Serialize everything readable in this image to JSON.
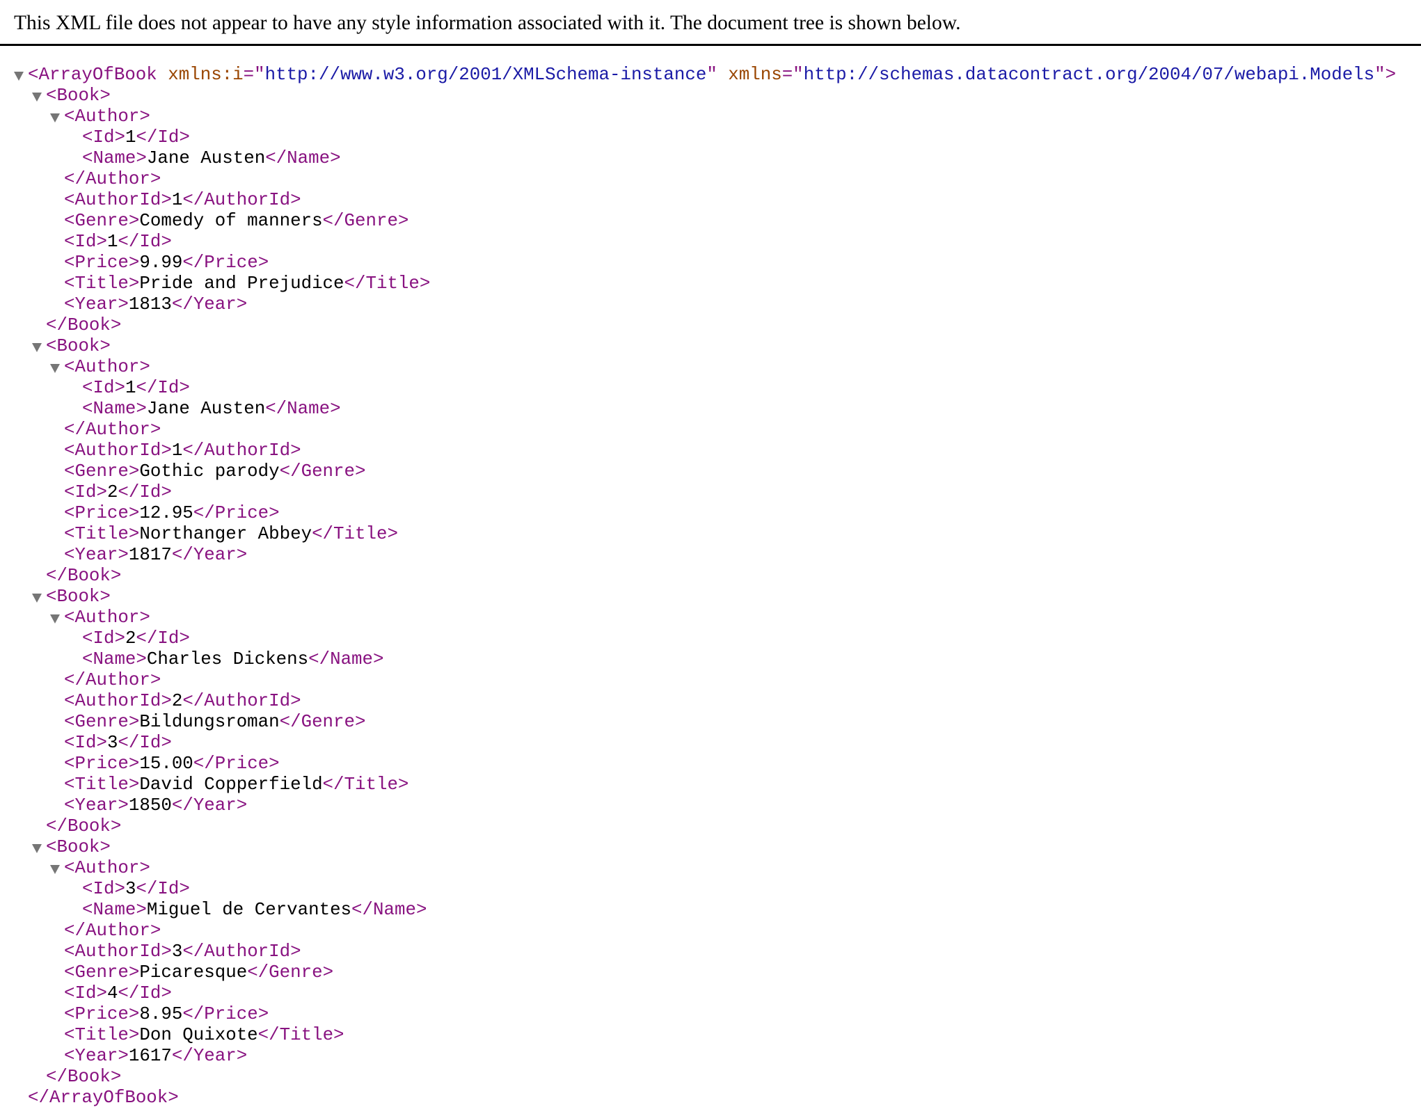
{
  "header": {
    "message": "This XML file does not appear to have any style information associated with it. The document tree is shown below."
  },
  "colors": {
    "tag": "#881280",
    "attr_name": "#994500",
    "attr_value": "#1a1aa6",
    "text": "#000000",
    "toggle": "#767676"
  },
  "icons": {
    "toggle": "triangle-down-icon"
  },
  "tree": {
    "lines": [
      {
        "depth": 0,
        "toggle": true,
        "kind": "open",
        "tag": "ArrayOfBook",
        "attrs": [
          {
            "name": "xmlns:i",
            "value": "http://www.w3.org/2001/XMLSchema-instance"
          },
          {
            "name": "xmlns",
            "value": "http://schemas.datacontract.org/2004/07/webapi.Models"
          }
        ]
      },
      {
        "depth": 1,
        "toggle": true,
        "kind": "open",
        "tag": "Book"
      },
      {
        "depth": 2,
        "toggle": true,
        "kind": "open",
        "tag": "Author"
      },
      {
        "depth": 3,
        "kind": "leaf",
        "tag": "Id",
        "text": "1"
      },
      {
        "depth": 3,
        "kind": "leaf",
        "tag": "Name",
        "text": "Jane Austen"
      },
      {
        "depth": 2,
        "kind": "close",
        "tag": "Author"
      },
      {
        "depth": 2,
        "kind": "leaf",
        "tag": "AuthorId",
        "text": "1"
      },
      {
        "depth": 2,
        "kind": "leaf",
        "tag": "Genre",
        "text": "Comedy of manners"
      },
      {
        "depth": 2,
        "kind": "leaf",
        "tag": "Id",
        "text": "1"
      },
      {
        "depth": 2,
        "kind": "leaf",
        "tag": "Price",
        "text": "9.99"
      },
      {
        "depth": 2,
        "kind": "leaf",
        "tag": "Title",
        "text": "Pride and Prejudice"
      },
      {
        "depth": 2,
        "kind": "leaf",
        "tag": "Year",
        "text": "1813"
      },
      {
        "depth": 1,
        "kind": "close",
        "tag": "Book"
      },
      {
        "depth": 1,
        "toggle": true,
        "kind": "open",
        "tag": "Book"
      },
      {
        "depth": 2,
        "toggle": true,
        "kind": "open",
        "tag": "Author"
      },
      {
        "depth": 3,
        "kind": "leaf",
        "tag": "Id",
        "text": "1"
      },
      {
        "depth": 3,
        "kind": "leaf",
        "tag": "Name",
        "text": "Jane Austen"
      },
      {
        "depth": 2,
        "kind": "close",
        "tag": "Author"
      },
      {
        "depth": 2,
        "kind": "leaf",
        "tag": "AuthorId",
        "text": "1"
      },
      {
        "depth": 2,
        "kind": "leaf",
        "tag": "Genre",
        "text": "Gothic parody"
      },
      {
        "depth": 2,
        "kind": "leaf",
        "tag": "Id",
        "text": "2"
      },
      {
        "depth": 2,
        "kind": "leaf",
        "tag": "Price",
        "text": "12.95"
      },
      {
        "depth": 2,
        "kind": "leaf",
        "tag": "Title",
        "text": "Northanger Abbey"
      },
      {
        "depth": 2,
        "kind": "leaf",
        "tag": "Year",
        "text": "1817"
      },
      {
        "depth": 1,
        "kind": "close",
        "tag": "Book"
      },
      {
        "depth": 1,
        "toggle": true,
        "kind": "open",
        "tag": "Book"
      },
      {
        "depth": 2,
        "toggle": true,
        "kind": "open",
        "tag": "Author"
      },
      {
        "depth": 3,
        "kind": "leaf",
        "tag": "Id",
        "text": "2"
      },
      {
        "depth": 3,
        "kind": "leaf",
        "tag": "Name",
        "text": "Charles Dickens"
      },
      {
        "depth": 2,
        "kind": "close",
        "tag": "Author"
      },
      {
        "depth": 2,
        "kind": "leaf",
        "tag": "AuthorId",
        "text": "2"
      },
      {
        "depth": 2,
        "kind": "leaf",
        "tag": "Genre",
        "text": "Bildungsroman"
      },
      {
        "depth": 2,
        "kind": "leaf",
        "tag": "Id",
        "text": "3"
      },
      {
        "depth": 2,
        "kind": "leaf",
        "tag": "Price",
        "text": "15.00"
      },
      {
        "depth": 2,
        "kind": "leaf",
        "tag": "Title",
        "text": "David Copperfield"
      },
      {
        "depth": 2,
        "kind": "leaf",
        "tag": "Year",
        "text": "1850"
      },
      {
        "depth": 1,
        "kind": "close",
        "tag": "Book"
      },
      {
        "depth": 1,
        "toggle": true,
        "kind": "open",
        "tag": "Book"
      },
      {
        "depth": 2,
        "toggle": true,
        "kind": "open",
        "tag": "Author"
      },
      {
        "depth": 3,
        "kind": "leaf",
        "tag": "Id",
        "text": "3"
      },
      {
        "depth": 3,
        "kind": "leaf",
        "tag": "Name",
        "text": "Miguel de Cervantes"
      },
      {
        "depth": 2,
        "kind": "close",
        "tag": "Author"
      },
      {
        "depth": 2,
        "kind": "leaf",
        "tag": "AuthorId",
        "text": "3"
      },
      {
        "depth": 2,
        "kind": "leaf",
        "tag": "Genre",
        "text": "Picaresque"
      },
      {
        "depth": 2,
        "kind": "leaf",
        "tag": "Id",
        "text": "4"
      },
      {
        "depth": 2,
        "kind": "leaf",
        "tag": "Price",
        "text": "8.95"
      },
      {
        "depth": 2,
        "kind": "leaf",
        "tag": "Title",
        "text": "Don Quixote"
      },
      {
        "depth": 2,
        "kind": "leaf",
        "tag": "Year",
        "text": "1617"
      },
      {
        "depth": 1,
        "kind": "close",
        "tag": "Book"
      },
      {
        "depth": 0,
        "kind": "close",
        "tag": "ArrayOfBook"
      }
    ]
  }
}
